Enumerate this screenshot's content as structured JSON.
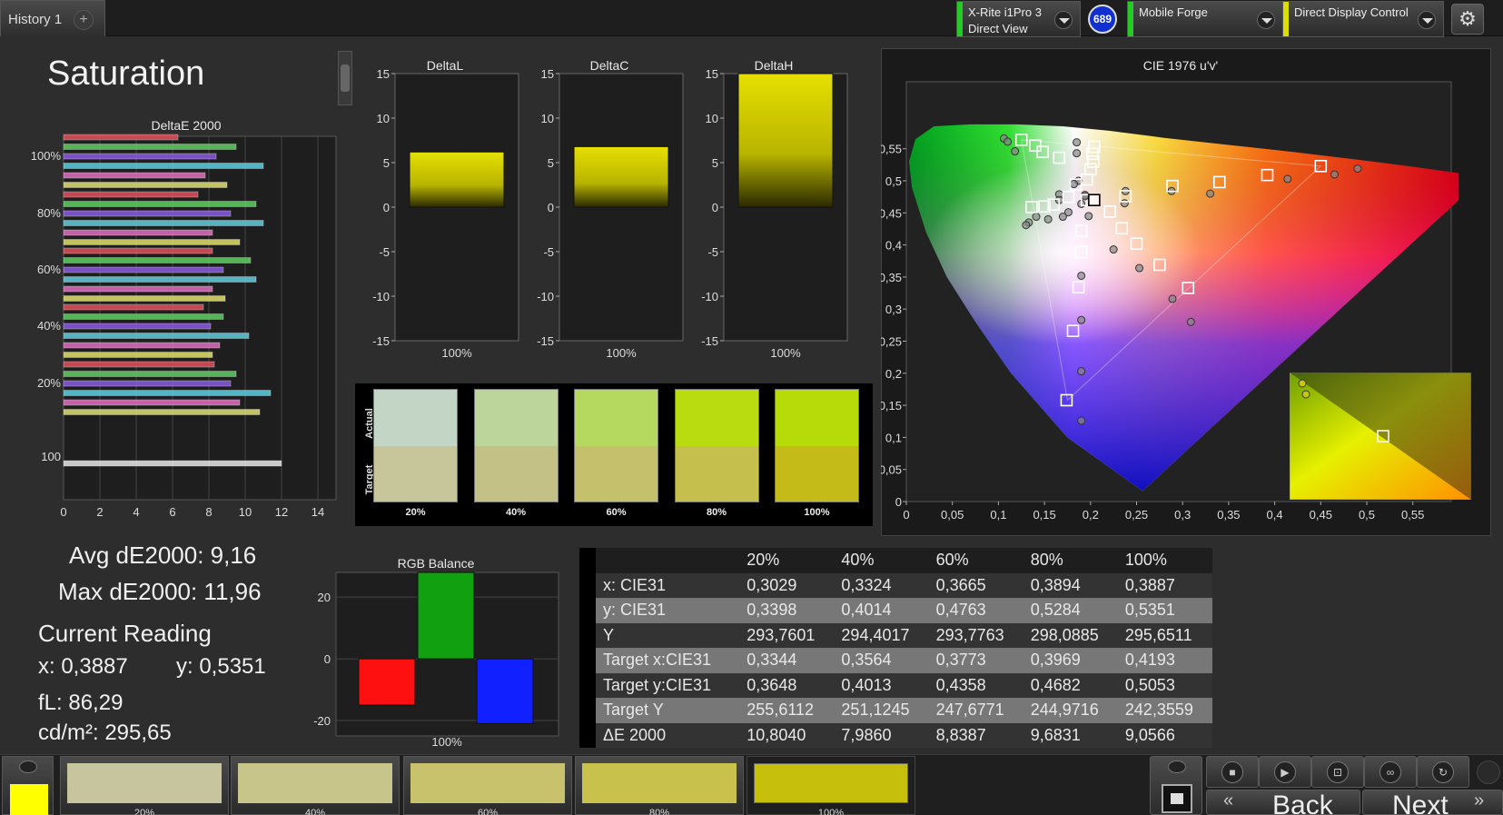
{
  "tabs": {
    "history": "History 1",
    "add": "+"
  },
  "devices": [
    {
      "line1": "X-Rite i1Pro 3",
      "line2": "Direct View",
      "color": "#22cc22"
    },
    {
      "line1": "Mobile Forge",
      "line2": "",
      "color": "#22cc22"
    },
    {
      "line1": "Direct Display Control",
      "line2": "",
      "color": "#dddd00"
    }
  ],
  "badge": "689",
  "icons": {
    "settings": "gear-icon",
    "dropdown": "chevron-down-icon"
  },
  "page_title": "Saturation",
  "deltae_chart": {
    "title": "DeltaE 2000",
    "x_ticks": [
      "0",
      "2",
      "4",
      "6",
      "8",
      "10",
      "12",
      "14"
    ],
    "y_labels": [
      "100%",
      "80%",
      "60%",
      "40%",
      "20%",
      "100"
    ]
  },
  "delta_charts": [
    {
      "title": "DeltaL",
      "value": 6.2,
      "category": "100%"
    },
    {
      "title": "DeltaC",
      "value": 6.8,
      "category": "100%"
    },
    {
      "title": "DeltaH",
      "value": 15,
      "category": "100%"
    }
  ],
  "delta_ticks": [
    "15",
    "10",
    "5",
    "0",
    "-5",
    "-10",
    "-15"
  ],
  "swatch_panel": {
    "actual_label": "Actual",
    "target_label": "Target",
    "items": [
      {
        "label": "20%",
        "actual": "#c3d6c6",
        "target": "#c7c59a"
      },
      {
        "label": "40%",
        "actual": "#bcd59b",
        "target": "#c4c187"
      },
      {
        "label": "60%",
        "actual": "#b5d95f",
        "target": "#c4c06c"
      },
      {
        "label": "80%",
        "actual": "#b8dc10",
        "target": "#c5c04e"
      },
      {
        "label": "100%",
        "actual": "#b6db08",
        "target": "#c4bb18"
      }
    ]
  },
  "cie": {
    "title": "CIE 1976 u'v'",
    "x_ticks": [
      "0",
      "0,05",
      "0,1",
      "0,15",
      "0,2",
      "0,25",
      "0,3",
      "0,35",
      "0,4",
      "0,45",
      "0,5",
      "0,55"
    ],
    "y_ticks": [
      "0,55",
      "0,5",
      "0,45",
      "0,4",
      "0,35",
      "0,3",
      "0,25",
      "0,2",
      "0,15",
      "0,1",
      "0,05",
      "0"
    ]
  },
  "summary": {
    "avg": "Avg dE2000: 9,16",
    "max": "Max dE2000: 11,96",
    "current_reading": "Current Reading",
    "x": "x: 0,3887",
    "y": "y: 0,5351",
    "fl": "fL: 86,29",
    "cdm2": "cd/m²: 295,65"
  },
  "rgb_balance": {
    "title": "RGB Balance",
    "y_ticks": [
      "20",
      "0",
      "-20"
    ],
    "category": "100%",
    "chart_data": {
      "type": "bar",
      "categories": [
        "R",
        "G",
        "B"
      ],
      "values": [
        -15,
        28,
        -21
      ],
      "ylim": [
        -25,
        28
      ]
    }
  },
  "table": {
    "headers": [
      "",
      "20%",
      "40%",
      "60%",
      "80%",
      "100%"
    ],
    "rows": [
      [
        "x: CIE31",
        "0,3029",
        "0,3324",
        "0,3665",
        "0,3894",
        "0,3887"
      ],
      [
        "y: CIE31",
        "0,3398",
        "0,4014",
        "0,4763",
        "0,5284",
        "0,5351"
      ],
      [
        "Y",
        "293,7601",
        "294,4017",
        "293,7763",
        "298,0885",
        "295,6511"
      ],
      [
        "Target x:CIE31",
        "0,3344",
        "0,3564",
        "0,3773",
        "0,3969",
        "0,4193"
      ],
      [
        "Target y:CIE31",
        "0,3648",
        "0,4013",
        "0,4358",
        "0,4682",
        "0,5053"
      ],
      [
        "Target Y",
        "255,6112",
        "251,1245",
        "247,6771",
        "244,9716",
        "242,3559"
      ],
      [
        "ΔE 2000",
        "10,8040",
        "7,9860",
        "8,8387",
        "9,6831",
        "9,0566"
      ]
    ]
  },
  "bottom_swatches": [
    {
      "label": "20%",
      "color": "#c6c59e"
    },
    {
      "label": "40%",
      "color": "#c8c58a"
    },
    {
      "label": "60%",
      "color": "#c8c26c"
    },
    {
      "label": "80%",
      "color": "#c8c24c"
    },
    {
      "label": "100%",
      "color": "#c6bf0c"
    }
  ],
  "current_color": "#ffff00",
  "nav": {
    "back": "Back",
    "next": "Next"
  },
  "chart_data": [
    {
      "type": "bar",
      "title": "DeltaE 2000",
      "orientation": "horizontal",
      "groups": [
        {
          "label": "100%",
          "values": [
            6.3,
            9.5,
            8.4,
            11,
            7.8,
            9
          ]
        },
        {
          "label": "80%",
          "values": [
            7.4,
            10.6,
            9.2,
            11,
            8.2,
            9.7
          ]
        },
        {
          "label": "60%",
          "values": [
            8.2,
            10.3,
            8.8,
            10.6,
            8.2,
            8.9
          ]
        },
        {
          "label": "40%",
          "values": [
            7.7,
            8.8,
            8.1,
            10.2,
            8.6,
            8.2
          ]
        },
        {
          "label": "20%",
          "values": [
            8.3,
            9.5,
            9.2,
            11.4,
            9.7,
            10.8
          ]
        },
        {
          "label": "100",
          "values": [
            12
          ]
        }
      ],
      "bar_colors": [
        "#e0505a",
        "#5fcf5f",
        "#8a5ae0",
        "#5fcfe0",
        "#e070c0",
        "#e0e070"
      ],
      "xlim": [
        0,
        15
      ]
    },
    {
      "type": "bar",
      "title": "DeltaL",
      "categories": [
        "100%"
      ],
      "values": [
        6.2
      ],
      "ylim": [
        -15,
        15
      ]
    },
    {
      "type": "bar",
      "title": "DeltaC",
      "categories": [
        "100%"
      ],
      "values": [
        6.8
      ],
      "ylim": [
        -15,
        15
      ]
    },
    {
      "type": "bar",
      "title": "DeltaH",
      "categories": [
        "100%"
      ],
      "values": [
        15
      ],
      "ylim": [
        -15,
        15
      ]
    },
    {
      "type": "scatter",
      "title": "CIE 1976 u'v'",
      "xlim": [
        0,
        0.6
      ],
      "ylim": [
        0,
        0.6
      ],
      "target_points": [
        [
          0.125,
          0.564
        ],
        [
          0.14,
          0.555
        ],
        [
          0.148,
          0.545
        ],
        [
          0.166,
          0.536
        ],
        [
          0.204,
          0.553
        ],
        [
          0.202,
          0.542
        ],
        [
          0.203,
          0.53
        ],
        [
          0.2,
          0.518
        ],
        [
          0.196,
          0.502
        ],
        [
          0.184,
          0.494
        ],
        [
          0.176,
          0.475
        ],
        [
          0.196,
          0.47
        ],
        [
          0.136,
          0.459
        ],
        [
          0.15,
          0.46
        ],
        [
          0.16,
          0.463
        ],
        [
          0.221,
          0.452
        ],
        [
          0.238,
          0.476
        ],
        [
          0.289,
          0.492
        ],
        [
          0.34,
          0.498
        ],
        [
          0.392,
          0.509
        ],
        [
          0.45,
          0.523
        ],
        [
          0.234,
          0.426
        ],
        [
          0.25,
          0.402
        ],
        [
          0.275,
          0.369
        ],
        [
          0.306,
          0.333
        ],
        [
          0.19,
          0.389
        ],
        [
          0.19,
          0.422
        ],
        [
          0.187,
          0.334
        ],
        [
          0.181,
          0.266
        ],
        [
          0.174,
          0.158
        ]
      ],
      "measured_points": [
        [
          0.106,
          0.566
        ],
        [
          0.11,
          0.561
        ],
        [
          0.118,
          0.546
        ],
        [
          0.185,
          0.56
        ],
        [
          0.185,
          0.543
        ],
        [
          0.187,
          0.5
        ],
        [
          0.182,
          0.495
        ],
        [
          0.166,
          0.479
        ],
        [
          0.166,
          0.47
        ],
        [
          0.176,
          0.451
        ],
        [
          0.19,
          0.464
        ],
        [
          0.141,
          0.444
        ],
        [
          0.133,
          0.435
        ],
        [
          0.13,
          0.431
        ],
        [
          0.154,
          0.44
        ],
        [
          0.17,
          0.444
        ],
        [
          0.198,
          0.445
        ],
        [
          0.237,
          0.465
        ],
        [
          0.238,
          0.484
        ],
        [
          0.288,
          0.484
        ],
        [
          0.33,
          0.48
        ],
        [
          0.414,
          0.503
        ],
        [
          0.465,
          0.51
        ],
        [
          0.49,
          0.519
        ],
        [
          0.225,
          0.393
        ],
        [
          0.253,
          0.364
        ],
        [
          0.289,
          0.316
        ],
        [
          0.309,
          0.28
        ],
        [
          0.19,
          0.352
        ],
        [
          0.19,
          0.283
        ],
        [
          0.19,
          0.203
        ],
        [
          0.19,
          0.126
        ],
        [
          0.194,
          0.478
        ],
        [
          0.194,
          0.476
        ]
      ]
    }
  ]
}
